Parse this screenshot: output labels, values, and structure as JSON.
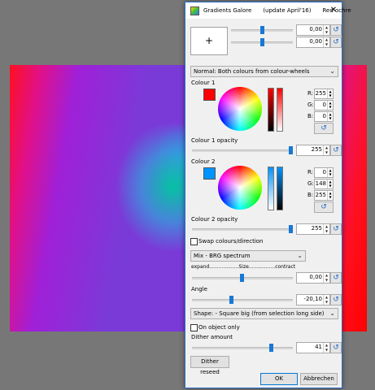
{
  "window": {
    "title": "Gradients Galore",
    "update": "(update April'16)",
    "preset": "Red ochre"
  },
  "preview": {
    "symbol": "+"
  },
  "top_sliders": [
    {
      "value": "0,00"
    },
    {
      "value": "0,00"
    }
  ],
  "mode": {
    "selected": "Normal: Both colours from colour-wheels"
  },
  "colour1": {
    "label": "Colour 1",
    "swatch": "#ff0000",
    "r_label": "R:",
    "g_label": "G:",
    "b_label": "B:",
    "r": "255",
    "g": "0",
    "b": "0",
    "opacity_label": "Colour 1 opacity",
    "opacity": "255",
    "opacity_level": 1.0
  },
  "colour2": {
    "label": "Colour 2",
    "swatch": "#0094ff",
    "r_label": "R:",
    "g_label": "G:",
    "b_label": "B:",
    "r": "0",
    "g": "148",
    "b": "255",
    "opacity_label": "Colour 2 opacity",
    "opacity": "255",
    "opacity_level": 1.0
  },
  "swap": {
    "label": "Swap colours/direction",
    "checked": false
  },
  "mix": {
    "selected": "Mix - BRG spectrum"
  },
  "size": {
    "label": "expand...................Size.................contract",
    "value": "0,00"
  },
  "angle": {
    "label": "Angle",
    "value": "-20,10"
  },
  "shape": {
    "selected": "Shape: - Square big (from selection long side)"
  },
  "on_object": {
    "label": "On object only",
    "checked": false
  },
  "dither": {
    "label": "Dither amount",
    "value": "41"
  },
  "buttons": {
    "reseed": "Dither reseed",
    "ok": "OK",
    "cancel": "Abbrechen"
  },
  "icons": {
    "reset": "reset-icon",
    "close": "close-icon",
    "dropdown": "chevron-down-icon"
  },
  "colors": {
    "accent": "#1778d6"
  }
}
